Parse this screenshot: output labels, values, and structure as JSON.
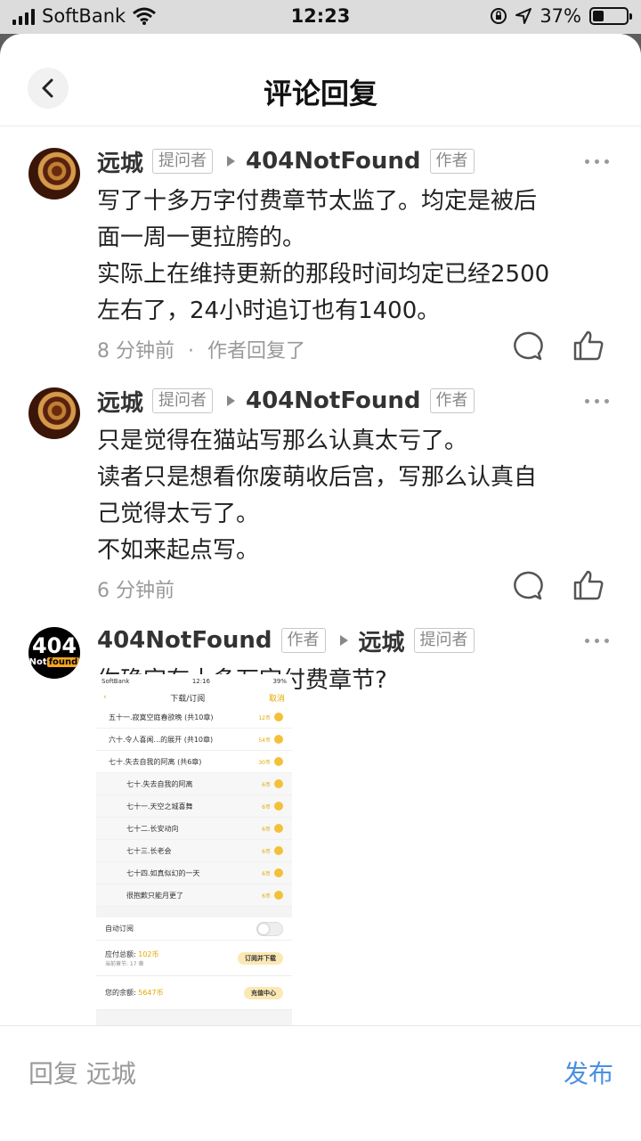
{
  "status_bar": {
    "carrier": "SoftBank",
    "time": "12:23",
    "battery": "37%"
  },
  "header": {
    "title": "评论回复"
  },
  "comments": [
    {
      "author": "远城",
      "author_tag": "提问者",
      "target": "404NotFound",
      "target_tag": "作者",
      "lines": [
        "写了十多万字付费章节太监了。均定是被后",
        "面一周一更拉胯的。",
        "实际上在维持更新的那段时间均定已经2500",
        "左右了，24小时追订也有1400。"
      ],
      "time": "8 分钟前",
      "sep": "·",
      "note": "作者回复了"
    },
    {
      "author": "远城",
      "author_tag": "提问者",
      "target": "404NotFound",
      "target_tag": "作者",
      "lines": [
        "只是觉得在猫站写那么认真太亏了。",
        "读者只是想看你废萌收后宫，写那么认真自",
        "己觉得太亏了。",
        "不如来起点写。"
      ],
      "time": "6 分钟前"
    },
    {
      "author": "404NotFound",
      "author_tag": "作者",
      "target": "远城",
      "target_tag": "提问者",
      "avatar_top": "404",
      "avatar_bottom_a": "Not",
      "avatar_bottom_b": "found",
      "lines": [
        "你确定有十多万字付费章节?"
      ]
    }
  ],
  "embedded_screenshot": {
    "carrier": "SoftBank",
    "time": "12:16",
    "battery": "39%",
    "title": "下载/订阅",
    "cancel": "取消",
    "rows": [
      {
        "label": "五十一.寂寞空庭春欲晚 (共10章)",
        "price": "12币"
      },
      {
        "label": "六十.令人喜闻...的展开 (共10章)",
        "price": "54币"
      },
      {
        "label": "七十.失去自我的阿离 (共6章)",
        "price": "30币"
      }
    ],
    "subrows": [
      {
        "label": "七十.失去自我的阿离",
        "price": "6币"
      },
      {
        "label": "七十一.天空之城喜舞",
        "price": "6币"
      },
      {
        "label": "七十二.长安动向",
        "price": "6币"
      },
      {
        "label": "七十三.长老会",
        "price": "6币"
      },
      {
        "label": "七十四.如真似幻的一天",
        "price": "6币"
      },
      {
        "label": "很抱歉只能月更了",
        "price": "6币"
      }
    ],
    "auto_sub": "自动订阅",
    "total_label": "应付总额:",
    "total_value": "102币",
    "count_label": "当前章节: 17 章",
    "buy_btn": "订阅并下载",
    "balance_label": "您的余额:",
    "balance_value": "5647币",
    "recharge_btn": "充值中心"
  },
  "footer": {
    "placeholder": "回复 远城",
    "publish": "发布"
  }
}
